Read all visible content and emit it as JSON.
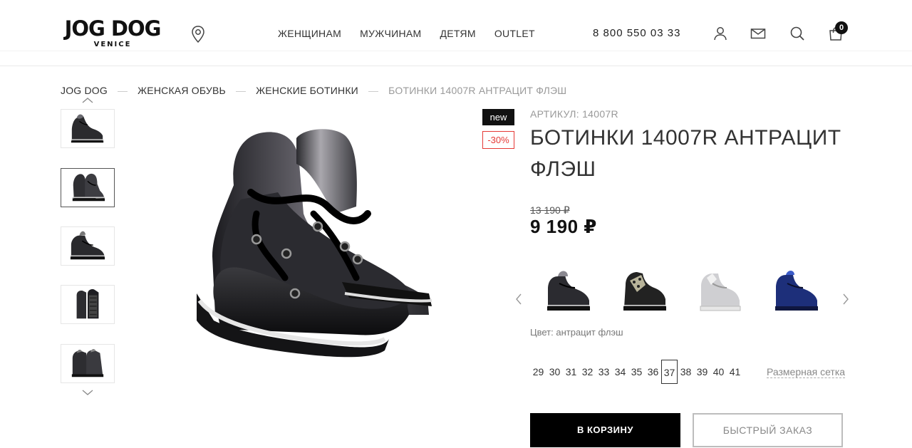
{
  "brand": {
    "logo_main": "JOG DOG",
    "logo_sub": "VENICE"
  },
  "header": {
    "nav": [
      "ЖЕНЩИНАМ",
      "МУЖЧИНАМ",
      "ДЕТЯМ",
      "OUTLET"
    ],
    "phone": "8 800 550 03 33",
    "icons": [
      "location-pin-icon",
      "user-icon",
      "mail-icon",
      "search-icon",
      "cart-icon"
    ],
    "cart_count": "0"
  },
  "breadcrumb": [
    "JOG DOG",
    "ЖЕНСКАЯ ОБУВЬ",
    "ЖЕНСКИЕ БОТИНКИ",
    "БОТИНКИ 14007R АНТРАЦИТ ФЛЭШ"
  ],
  "gallery": {
    "thumbnails": [
      "pair-side-view",
      "pair-front-view",
      "single-side-view",
      "sole-view",
      "pair-back-view"
    ],
    "active_index": 1,
    "badge_new": "new",
    "badge_sale": "-30%"
  },
  "product": {
    "sku": "АРТИКУЛ: 14007R",
    "title": "БОТИНКИ 14007R АНТРАЦИТ ФЛЭШ",
    "old_price": "13 190 ₽",
    "price": "9 190 ₽",
    "color_label": "Цвет: антрацит флэш",
    "color_variants": [
      "антрацит флэш",
      "leopard-silver",
      "silver",
      "blue"
    ],
    "sizes": [
      "29",
      "30",
      "31",
      "32",
      "33",
      "34",
      "35",
      "36",
      "37",
      "38",
      "39",
      "40",
      "41"
    ],
    "selected_size": "37",
    "size_chart_label": "Размерная сетка",
    "add_to_cart": "В КОРЗИНУ",
    "quick_order": "БЫСТРЫЙ ЗАКАЗ"
  },
  "colors": {
    "accent": "#000000",
    "sale": "#e53935",
    "muted": "#999999"
  }
}
